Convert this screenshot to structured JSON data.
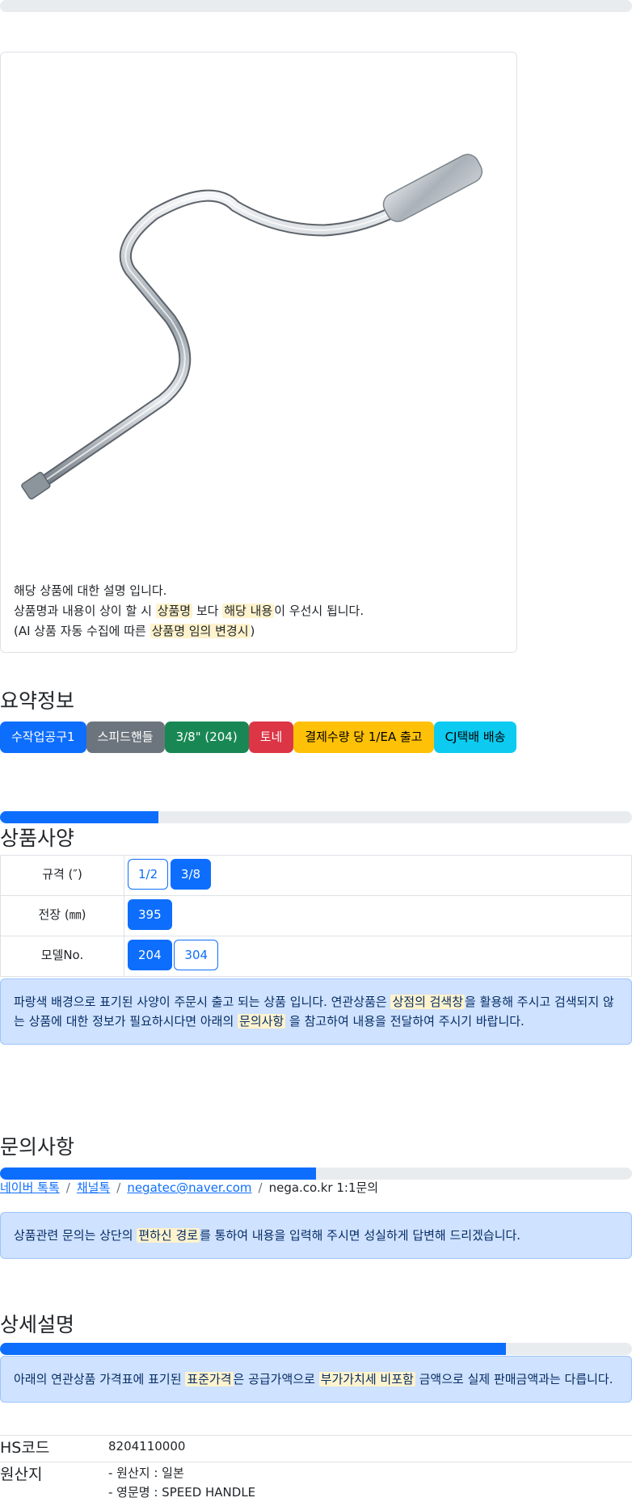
{
  "top_progress": {
    "percent": 0
  },
  "product_card": {
    "image_alt_icon": "speed-handle-image",
    "desc_line1": "해당 상품에 대한 설명 입니다.",
    "desc_line2_a": "상품명과 내용이 상이 할 시",
    "desc_line2_hl1": "상품명",
    "desc_line2_b": "보다",
    "desc_line2_hl2": "해당 내용",
    "desc_line2_c": "이 우선시 됩니다.",
    "desc_line3_a": "(AI 상품 자동 수집에 따른",
    "desc_line3_hl": "상품명 임의 변경시",
    "desc_line3_b": ")"
  },
  "summary": {
    "title": "요약정보",
    "badges": [
      {
        "label": "수작업공구1",
        "style": "primary"
      },
      {
        "label": "스피드핸들",
        "style": "secondary"
      },
      {
        "label": "3/8\" (204)",
        "style": "success"
      },
      {
        "label": "토네",
        "style": "danger"
      },
      {
        "label": "결제수량 당 1/EA 출고",
        "style": "warning"
      },
      {
        "label": "CJ택배 배송",
        "style": "info"
      }
    ]
  },
  "spec_progress": {
    "percent": 25
  },
  "spec": {
    "title": "상품사양",
    "rows": [
      {
        "label": "규격 (″)",
        "options": [
          {
            "label": "1/2",
            "selected": false
          },
          {
            "label": "3/8",
            "selected": true
          }
        ]
      },
      {
        "label": "전장 (㎜)",
        "options": [
          {
            "label": "395",
            "selected": true
          }
        ]
      },
      {
        "label": "모델No.",
        "options": [
          {
            "label": "204",
            "selected": true
          },
          {
            "label": "304",
            "selected": false
          }
        ]
      }
    ],
    "notice_a": "파랑색 배경으로 표기된 사양이 주문시 출고 되는 상품 입니다. 연관상품은",
    "notice_hl1": "상점의 검색창",
    "notice_b": "을 활용해 주시고 검색되지 않는 상품에 대한 정보가 필요하시다면 아래의",
    "notice_hl2": "문의사항",
    "notice_c": "을 참고하여 내용을 전달하여 주시기 바랍니다."
  },
  "inquiry": {
    "title": "문의사항",
    "progress_percent": 50,
    "links": [
      "네이버 톡톡",
      "채널톡",
      "negatec@naver.com"
    ],
    "plain": "nega.co.kr 1:1문의",
    "separator": "/",
    "notice_a": "상품관련 문의는 상단의",
    "notice_hl": "편하신 경로",
    "notice_b": "를 통하여 내용을 입력해 주시면 성실하게 답변해 드리겠습니다."
  },
  "detail": {
    "title": "상세설명",
    "progress_percent": 80,
    "notice_a": "아래의 연관상품 가격표에 표기된",
    "notice_hl1": "표준가격",
    "notice_b": "은 공급가액으로",
    "notice_hl2": "부가가치세 비포함",
    "notice_c": "금액으로 실제 판매금액과는 다릅니다.",
    "hs_label": "HS코드",
    "hs_value": "8204110000",
    "origin_label": "원산지",
    "origin_line1": "- 원산지 : 일본",
    "origin_line2": "- 영문명 : SPEED HANDLE"
  },
  "colors": {
    "primary": "#0d6efd",
    "alert_bg": "#cfe2ff",
    "highlight": "#fff3cd"
  }
}
